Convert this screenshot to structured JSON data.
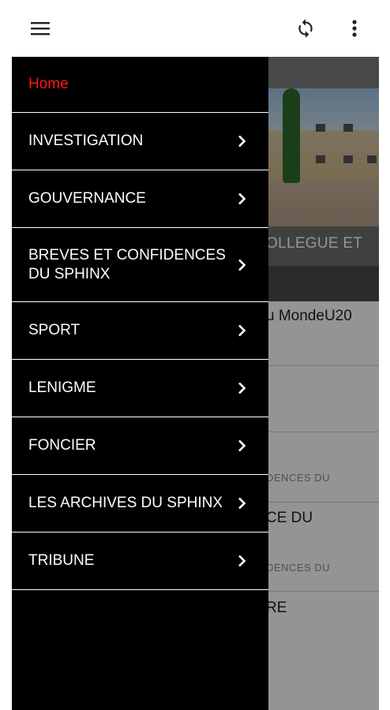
{
  "toolbar": {
    "menu_icon": "hamburger-menu-icon",
    "refresh_icon": "refresh-icon",
    "more_icon": "more-vert-icon"
  },
  "drawer": {
    "items": [
      {
        "label": "Home",
        "active": true,
        "has_submenu": false
      },
      {
        "label": "INVESTIGATION",
        "has_submenu": true
      },
      {
        "label": "GOUVERNANCE",
        "has_submenu": true
      },
      {
        "label": "BREVES ET CONFIDENCES DU SPHINX",
        "has_submenu": true
      },
      {
        "label": "SPORT",
        "has_submenu": true
      },
      {
        "label": "LENIGME",
        "has_submenu": true
      },
      {
        "label": "FONCIER",
        "has_submenu": true
      },
      {
        "label": "LES ARCHIVES DU SPHINX",
        "has_submenu": true
      },
      {
        "label": "TRIBUNE",
        "has_submenu": true
      }
    ],
    "active_color": "#ff1a1a"
  },
  "background": {
    "hero_caption": "OLLEGUE ET",
    "items": [
      {
        "title": "u MondeU20"
      },
      {
        "subtitle": "DENCES DU"
      },
      {
        "title": "CE DU"
      },
      {
        "subtitle": "DENCES DU"
      },
      {
        "title": "RE"
      }
    ]
  }
}
